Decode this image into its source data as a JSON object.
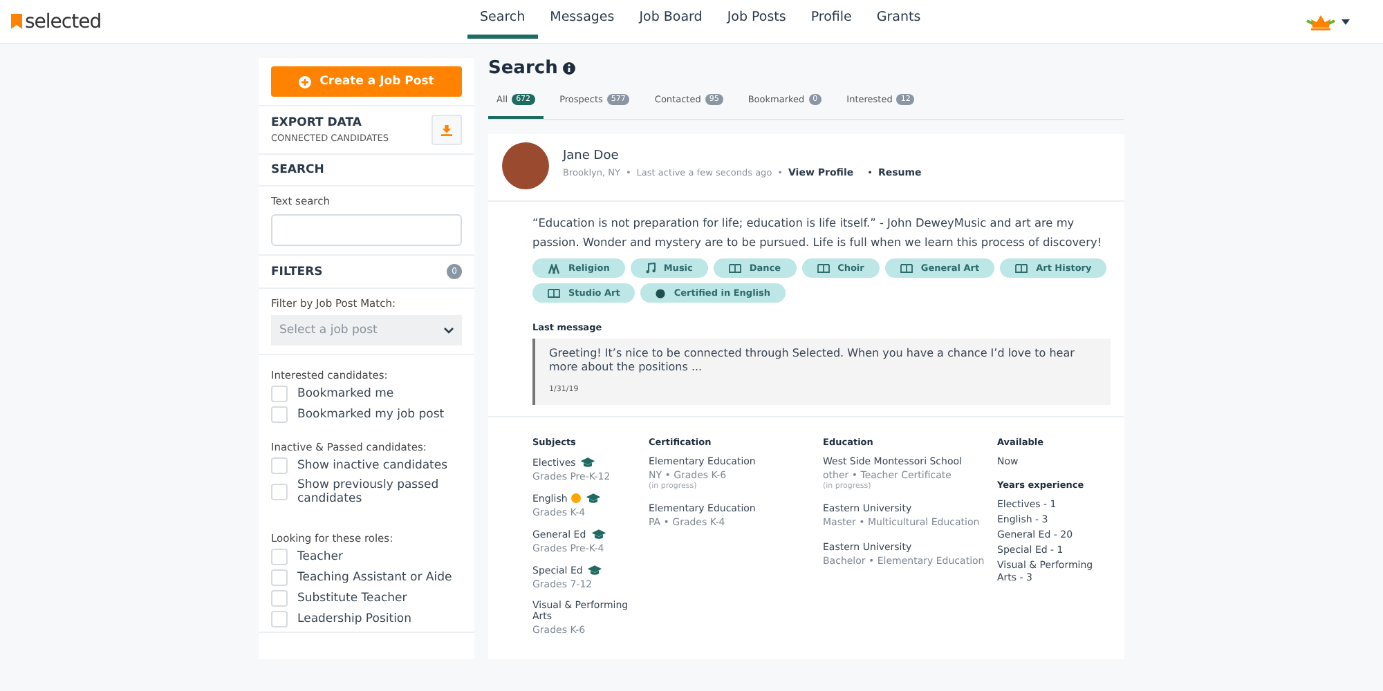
{
  "header": {
    "logo": "selected",
    "nav": [
      {
        "label": "Search",
        "selected": true
      },
      {
        "label": "Messages",
        "selected": false
      },
      {
        "label": "Job Board",
        "selected": false
      },
      {
        "label": "Job Posts",
        "selected": false
      },
      {
        "label": "Profile",
        "selected": false
      },
      {
        "label": "Grants",
        "selected": false
      }
    ]
  },
  "sidebar": {
    "create_button": "Create a Job Post",
    "export": {
      "title": "EXPORT DATA",
      "subtitle": "CONNECTED CANDIDATES"
    },
    "search": {
      "title": "SEARCH",
      "label": "Text search"
    },
    "filters": {
      "title": "FILTERS",
      "count": "0",
      "job_match_label": "Filter by Job Post Match:",
      "job_match_placeholder": "Select a job post",
      "groups": [
        {
          "label": "Interested candidates:",
          "options": [
            {
              "label": "Bookmarked me",
              "checked": false
            },
            {
              "label": "Bookmarked my job post",
              "checked": false
            }
          ]
        },
        {
          "label": "Inactive & Passed candidates:",
          "options": [
            {
              "label": "Show inactive candidates",
              "checked": false
            },
            {
              "label": "Show previously passed candidates",
              "checked": false
            }
          ]
        },
        {
          "label": "Looking for these roles:",
          "options": [
            {
              "label": "Teacher",
              "checked": false
            },
            {
              "label": "Teaching Assistant or Aide",
              "checked": false
            },
            {
              "label": "Substitute Teacher",
              "checked": false
            },
            {
              "label": "Leadership Position",
              "checked": false
            }
          ]
        }
      ]
    }
  },
  "main": {
    "title": "Search",
    "tabs": [
      {
        "label": "All",
        "count": "672",
        "selected": true
      },
      {
        "label": "Prospects",
        "count": "577",
        "selected": false
      },
      {
        "label": "Contacted",
        "count": "95",
        "selected": false
      },
      {
        "label": "Bookmarked",
        "count": "0",
        "selected": false
      },
      {
        "label": "Interested",
        "count": "12",
        "selected": false
      }
    ],
    "candidate": {
      "name": "Jane Doe",
      "location": "Brooklyn, NY",
      "last_active": "Last active a few seconds ago",
      "separators": [
        "•",
        "•",
        "•"
      ],
      "view_profile": "View Profile",
      "resume": "Resume",
      "bio": "“Education is not preparation for life; education is life itself.” - John DeweyMusic and art are my passion. Wonder and mystery are to be pursued. Life is full when we learn this process of discovery!",
      "tags": [
        {
          "label": "Religion",
          "kind": "people"
        },
        {
          "label": "Music",
          "kind": "music"
        },
        {
          "label": "Dance",
          "kind": "book"
        },
        {
          "label": "Choir",
          "kind": "book"
        },
        {
          "label": "General Art",
          "kind": "book"
        },
        {
          "label": "Art History",
          "kind": "book"
        },
        {
          "label": "Studio Art",
          "kind": "book"
        },
        {
          "label": "Certified in English",
          "kind": "dot"
        }
      ],
      "last_message": {
        "title": "Last message",
        "text": "Greeting! It’s nice to be connected through Selected. When you have a chance I’d love to hear more about the positions ...",
        "date": "1/31/19"
      },
      "subjects": {
        "title": "Subjects",
        "items": [
          {
            "name": "Electives",
            "grades": "Grades Pre-K-12",
            "flagged": false,
            "certified": true
          },
          {
            "name": "English",
            "grades": "Grades K-4",
            "flagged": true,
            "certified": true
          },
          {
            "name": "General Ed",
            "grades": "Grades Pre-K-4",
            "flagged": false,
            "certified": true
          },
          {
            "name": "Special Ed",
            "grades": "Grades 7-12",
            "flagged": false,
            "certified": true
          },
          {
            "name": "Visual & Performing Arts",
            "grades": "Grades K-6",
            "flagged": false,
            "certified": false
          }
        ]
      },
      "certification": {
        "title": "Certification",
        "items": [
          {
            "name": "Elementary Education",
            "detail": "NY • Grades K-6",
            "note": "(in progress)"
          },
          {
            "name": "Elementary Education",
            "detail": "PA • Grades K-4"
          }
        ]
      },
      "education": {
        "title": "Education",
        "items": [
          {
            "name": "West Side Montessori School",
            "detail": "other • Teacher Certificate",
            "note": "(in progress)"
          },
          {
            "name": "Eastern University",
            "detail": "Master • Multicultural Education"
          },
          {
            "name": "Eastern University",
            "detail": "Bachelor • Elementary Education"
          }
        ]
      },
      "available": {
        "title": "Available",
        "value": "Now"
      },
      "experience": {
        "title": "Years experience",
        "items": [
          "Electives - 1",
          "English - 3",
          "General Ed - 20",
          "Special Ed - 1",
          "Visual & Performing Arts - 3"
        ]
      }
    }
  }
}
